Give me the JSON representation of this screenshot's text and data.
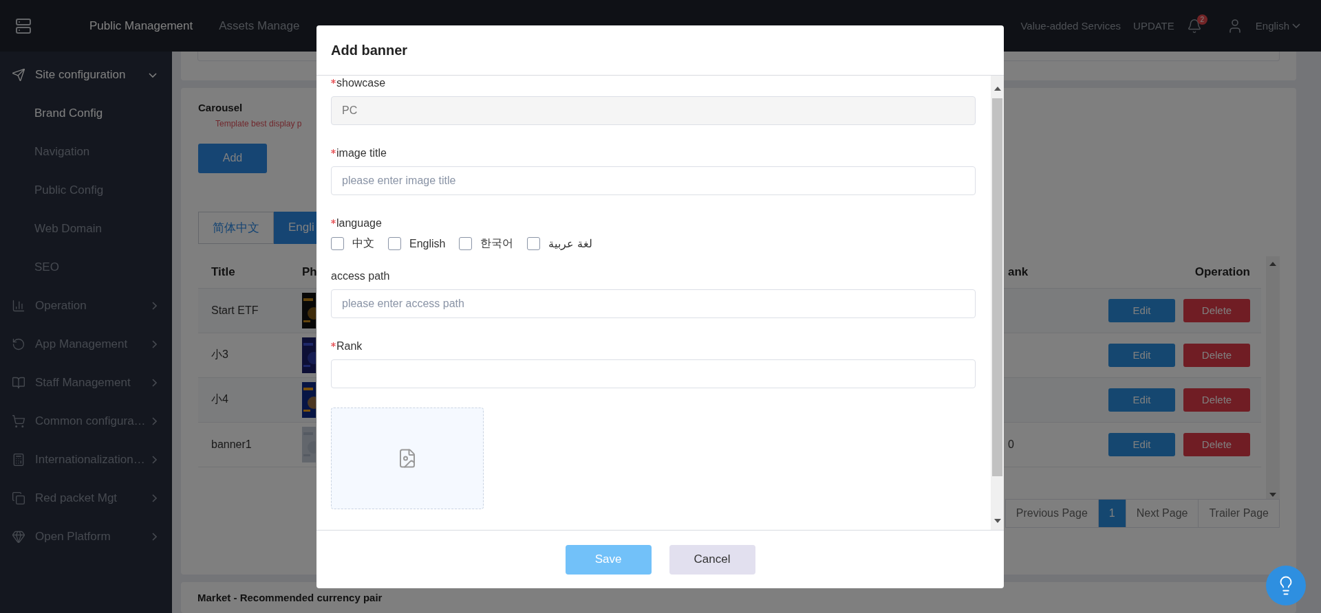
{
  "topbar": {
    "menu": [
      {
        "label": "Public Management",
        "selected": true
      },
      {
        "label": "Assets Manage",
        "selected": false
      }
    ],
    "right_menu": [
      {
        "label": "Value-added Services",
        "selected": false
      },
      {
        "label": "UPDATE",
        "selected": false
      }
    ],
    "notifications": "2",
    "language": "English"
  },
  "sidebar": {
    "items": [
      {
        "label": "Site configuration",
        "expanded": true,
        "children": [
          {
            "label": "Brand Config",
            "selected": true
          },
          {
            "label": "Navigation",
            "selected": false
          },
          {
            "label": "Public Config",
            "selected": false
          },
          {
            "label": "Web Domain",
            "selected": false
          },
          {
            "label": "SEO",
            "selected": false
          }
        ]
      },
      {
        "label": "Operation",
        "expanded": false
      },
      {
        "label": "App Management",
        "expanded": false
      },
      {
        "label": "Staff Management",
        "expanded": false
      },
      {
        "label": "Common configura…",
        "expanded": false
      },
      {
        "label": "Internationalization…",
        "expanded": false
      },
      {
        "label": "Red packet Mgt",
        "expanded": false
      },
      {
        "label": "Open Platform",
        "expanded": false
      }
    ]
  },
  "carousel": {
    "title": "Carousel",
    "hint": "Template best display p",
    "add_button": "Add",
    "tabs": [
      {
        "label": "简体中文",
        "selected": false
      },
      {
        "label": "Engli",
        "selected": true
      }
    ],
    "table": {
      "columns": [
        "Title",
        "Ph",
        "ank",
        "Operation"
      ],
      "rows": [
        {
          "title": "Start ETF",
          "edit": "Edit",
          "delete": "Delete"
        },
        {
          "title": "小3",
          "edit": "Edit",
          "delete": "Delete"
        },
        {
          "title": "小4",
          "edit": "Edit",
          "delete": "Delete"
        },
        {
          "title": "banner1",
          "rank": "0",
          "edit": "Edit",
          "delete": "Delete"
        }
      ]
    },
    "pagination": [
      {
        "label": "Previous Page",
        "selected": false
      },
      {
        "label": "1",
        "selected": true
      },
      {
        "label": "Next Page",
        "selected": false
      },
      {
        "label": "Trailer Page",
        "selected": false
      }
    ]
  },
  "market": {
    "title": "Market - Recommended currency pair"
  },
  "dialog": {
    "title": "Add banner",
    "fields": [
      {
        "kind": "input",
        "label": "showcase",
        "required": true,
        "value": "PC",
        "disabled": true
      },
      {
        "kind": "input",
        "label": "image title",
        "required": true,
        "placeholder": "please enter image title"
      },
      {
        "kind": "checkboxes",
        "label": "language",
        "required": true,
        "options": [
          {
            "label": "中文",
            "checked": false
          },
          {
            "label": "English",
            "checked": false
          },
          {
            "label": "한국어",
            "checked": false
          },
          {
            "label": "لغة عربية",
            "checked": false
          }
        ]
      },
      {
        "kind": "input",
        "label": "access path",
        "required": false,
        "placeholder": "please enter access path"
      },
      {
        "kind": "input",
        "label": "Rank",
        "required": true
      },
      {
        "kind": "upload"
      }
    ],
    "buttons": [
      {
        "label": "Save",
        "kind": "primary"
      },
      {
        "label": "Cancel",
        "kind": "secondary"
      }
    ]
  }
}
